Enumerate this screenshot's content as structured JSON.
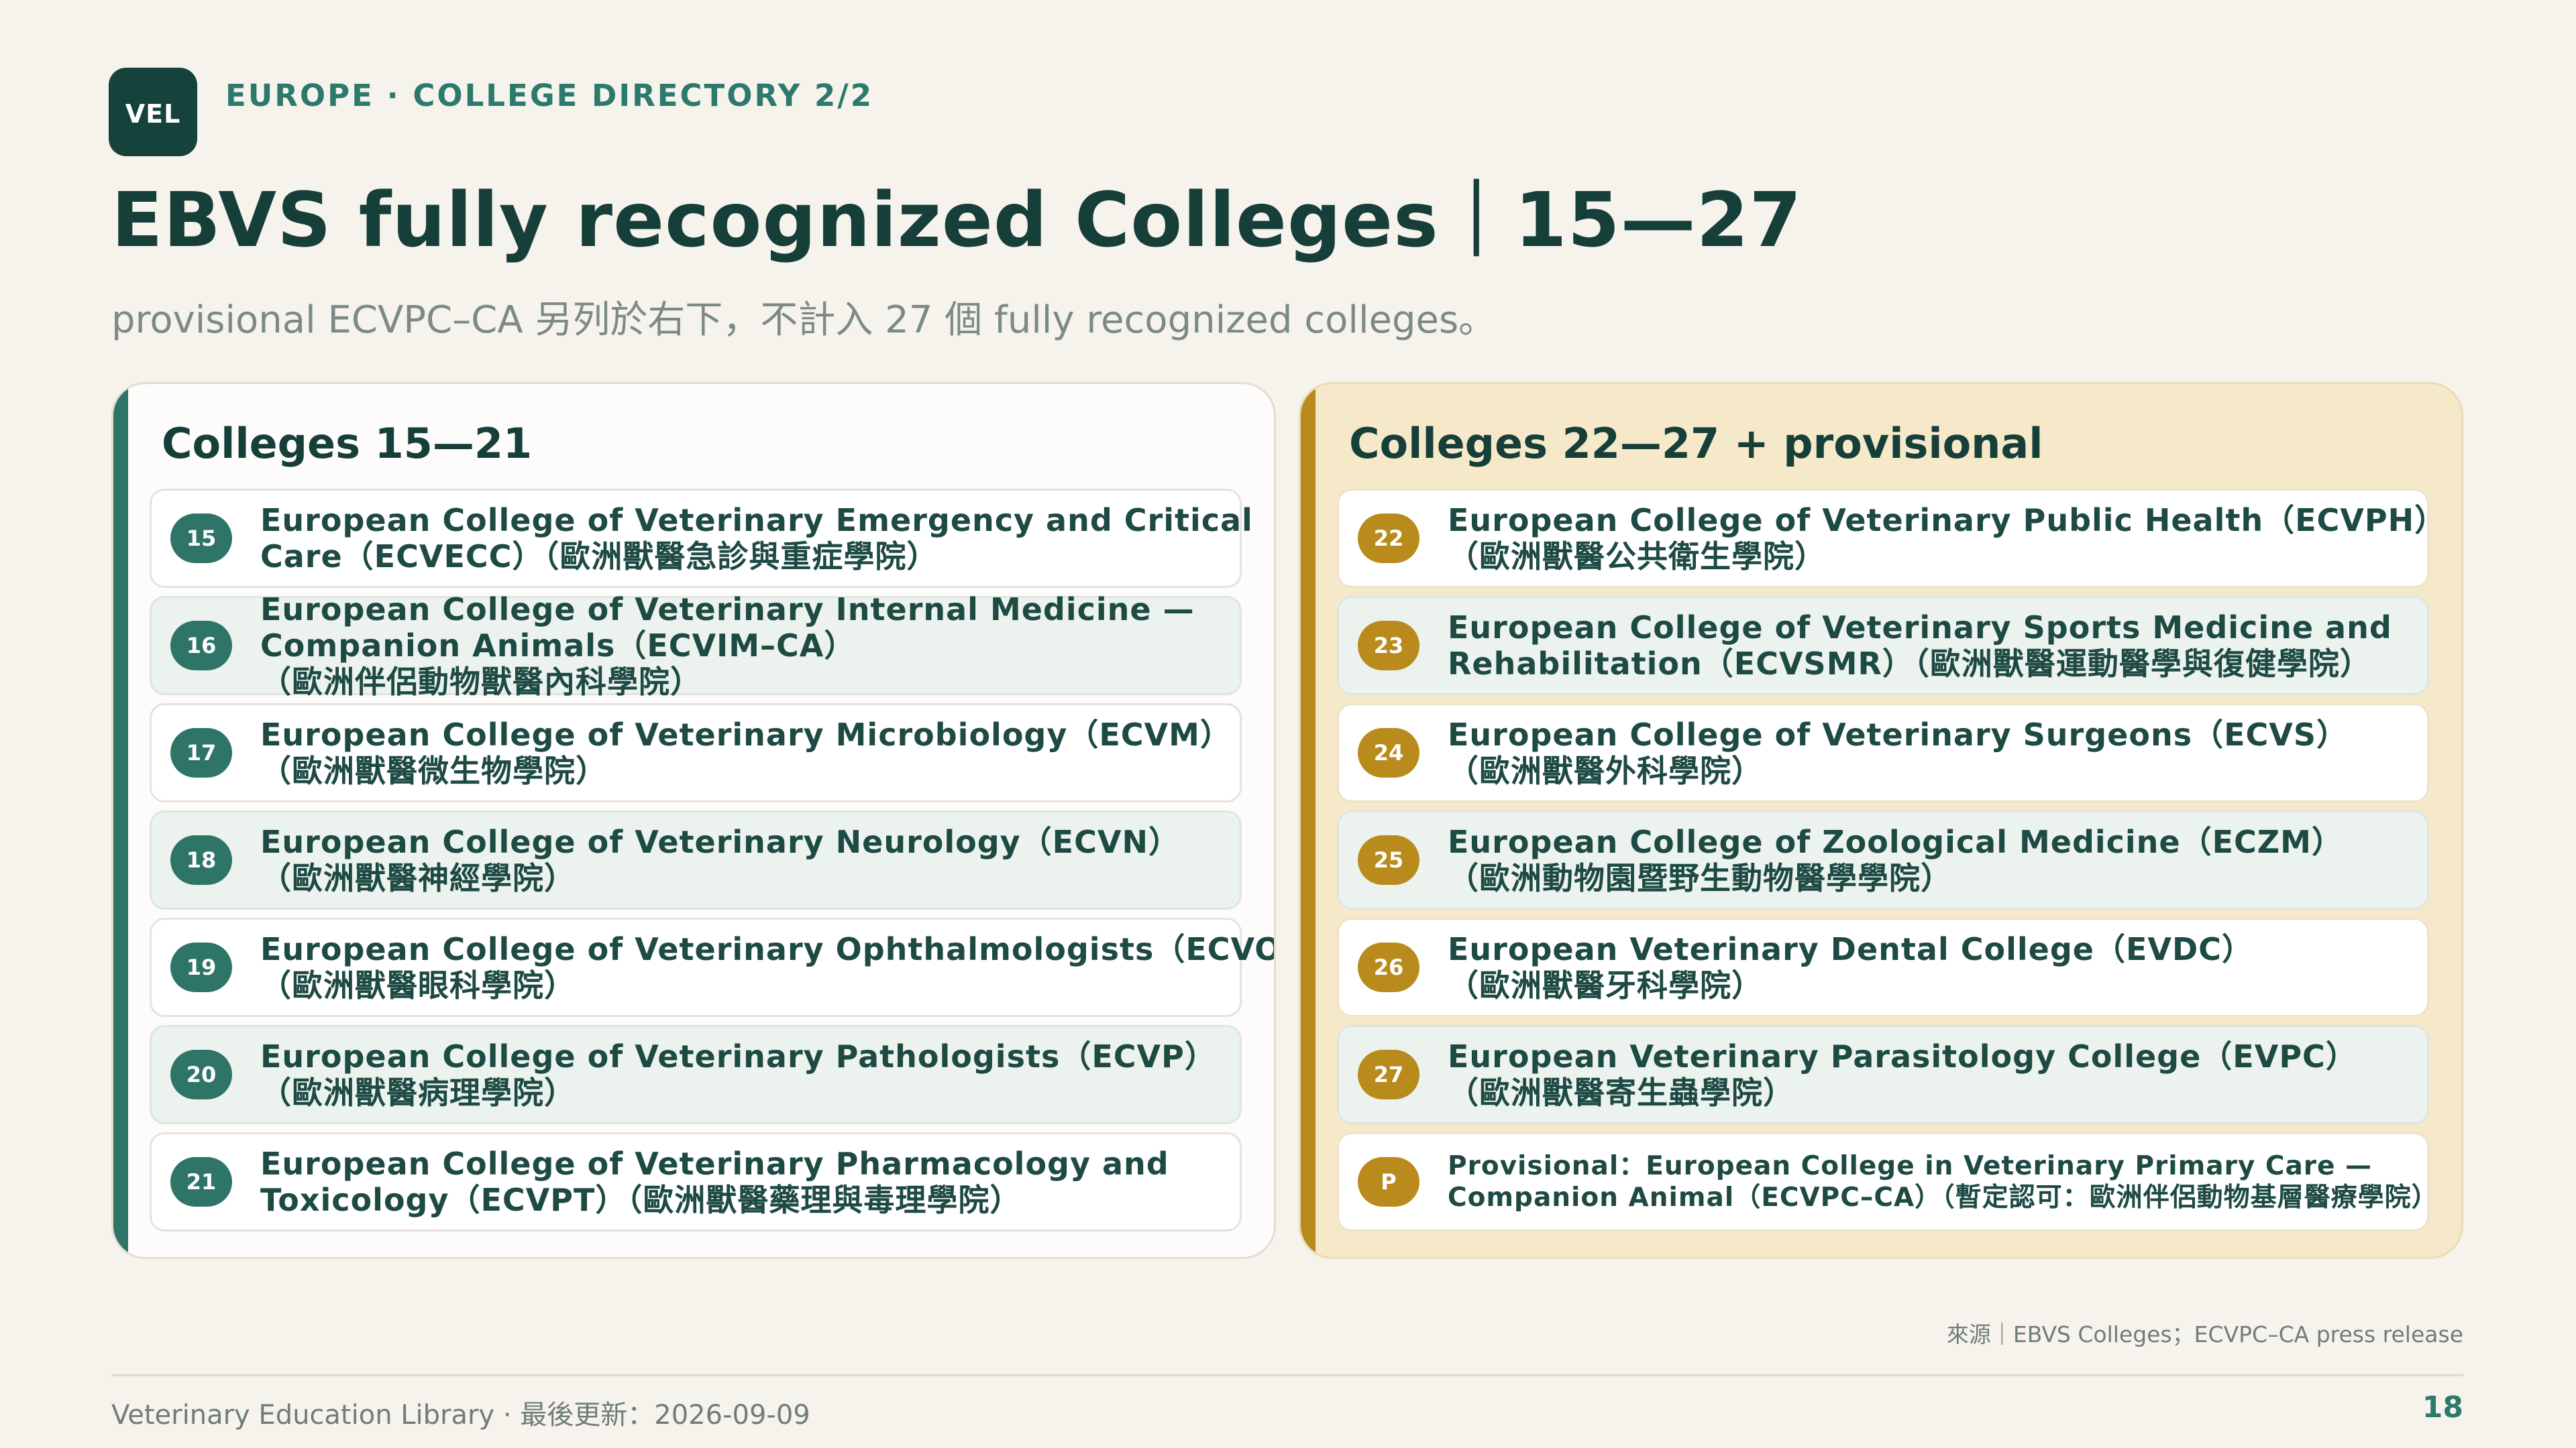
{
  "header": {
    "logo": "VEL",
    "eyebrow": "EUROPE · COLLEGE DIRECTORY 2/2",
    "title": "EBVS fully recognized Colleges｜15—27",
    "subtitle": "provisional ECVPC–CA 另列於右下，不計入 27 個 fully recognized colleges。"
  },
  "left_panel": {
    "title": "Colleges 15—21",
    "items": [
      {
        "badge": "15",
        "lines": [
          "European College of Veterinary Emergency and Critical",
          "Care（ECVECC）（歐洲獸醫急診與重症學院）"
        ]
      },
      {
        "badge": "16",
        "lines": [
          "European College of Veterinary Internal Medicine —",
          "Companion Animals（ECVIM–CA）",
          "（歐洲伴侶動物獸醫內科學院）"
        ]
      },
      {
        "badge": "17",
        "lines": [
          "European College of Veterinary Microbiology（ECVM）",
          "（歐洲獸醫微生物學院）"
        ]
      },
      {
        "badge": "18",
        "lines": [
          "European College of Veterinary Neurology（ECVN）",
          "（歐洲獸醫神經學院）"
        ]
      },
      {
        "badge": "19",
        "lines": [
          "European College of Veterinary Ophthalmologists（ECVO）",
          "（歐洲獸醫眼科學院）"
        ]
      },
      {
        "badge": "20",
        "lines": [
          "European College of Veterinary Pathologists（ECVP）",
          "（歐洲獸醫病理學院）"
        ]
      },
      {
        "badge": "21",
        "lines": [
          "European College of Veterinary Pharmacology and",
          "Toxicology（ECVPT）（歐洲獸醫藥理與毒理學院）"
        ]
      }
    ]
  },
  "right_panel": {
    "title": "Colleges 22—27 + provisional",
    "items": [
      {
        "badge": "22",
        "lines": [
          "European College of Veterinary Public Health（ECVPH）",
          "（歐洲獸醫公共衛生學院）"
        ]
      },
      {
        "badge": "23",
        "lines": [
          "European College of Veterinary Sports Medicine and",
          "Rehabilitation（ECVSMR）（歐洲獸醫運動醫學與復健學院）"
        ]
      },
      {
        "badge": "24",
        "lines": [
          "European College of Veterinary Surgeons（ECVS）",
          "（歐洲獸醫外科學院）"
        ]
      },
      {
        "badge": "25",
        "lines": [
          "European College of Zoological Medicine（ECZM）",
          "（歐洲動物園暨野生動物醫學學院）"
        ]
      },
      {
        "badge": "26",
        "lines": [
          "European Veterinary Dental College（EVDC）",
          "（歐洲獸醫牙科學院）"
        ]
      },
      {
        "badge": "27",
        "lines": [
          "European Veterinary Parasitology College（EVPC）",
          "（歐洲獸醫寄生蟲學院）"
        ]
      },
      {
        "badge": "P",
        "lines": [
          "Provisional：European College in Veterinary Primary Care —",
          "Companion Animal（ECVPC–CA）（暫定認可：歐洲伴侶動物基層醫療學院）"
        ]
      }
    ]
  },
  "source": "來源｜EBVS Colleges；ECVPC–CA press release",
  "footer": {
    "text": "Veterinary Education Library · 最後更新：2026-09-09",
    "page": "18"
  },
  "colors": {
    "background": "#f6f2ec",
    "primary_green": "#2e7568",
    "accent_gold": "#b98b1d",
    "dark_text": "#173f3a"
  }
}
